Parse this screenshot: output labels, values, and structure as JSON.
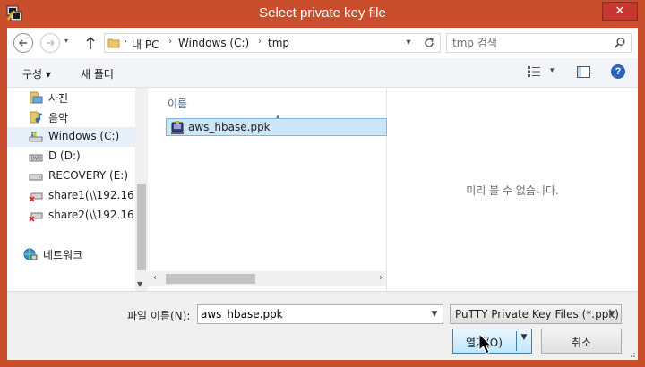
{
  "window": {
    "title": "Select private key file",
    "app_icon": "putty-icon",
    "close_label": "✕",
    "accent": "#c94f2c"
  },
  "nav": {
    "back_icon": "back-arrow-icon",
    "forward_icon": "forward-arrow-icon",
    "up_icon": "up-arrow-icon",
    "breadcrumb": [
      "내 PC",
      "Windows (C:)",
      "tmp"
    ],
    "search_placeholder": "tmp 검색"
  },
  "toolbar": {
    "organize": "구성 ▾",
    "new_folder": "새 폴더",
    "help": "?"
  },
  "sidebar": {
    "items": [
      {
        "label": "사진",
        "icon": "pictures-icon"
      },
      {
        "label": "음악",
        "icon": "music-icon"
      },
      {
        "label": "Windows (C:)",
        "icon": "drive-c-icon",
        "selected": true
      },
      {
        "label": "D (D:)",
        "icon": "dvd-drive-icon"
      },
      {
        "label": "RECOVERY (E:)",
        "icon": "drive-icon"
      },
      {
        "label": "share1(\\\\192.16",
        "icon": "network-drive-disconnected-icon"
      },
      {
        "label": "share2(\\\\192.16",
        "icon": "network-drive-disconnected-icon"
      },
      {
        "label": "네트워크",
        "icon": "network-icon"
      }
    ]
  },
  "file_list": {
    "column_header": "이름",
    "files": [
      {
        "name": "aws_hbase.ppk",
        "icon": "ppk-key-file-icon",
        "selected": true
      }
    ]
  },
  "preview": {
    "message": "미리 볼 수 없습니다."
  },
  "bottom": {
    "filename_label": "파일 이름(N):",
    "filename_value": "aws_hbase.ppk",
    "file_type": "PuTTY Private Key Files (*.ppk)",
    "open_label": "열기(O)",
    "cancel_label": "취소"
  }
}
